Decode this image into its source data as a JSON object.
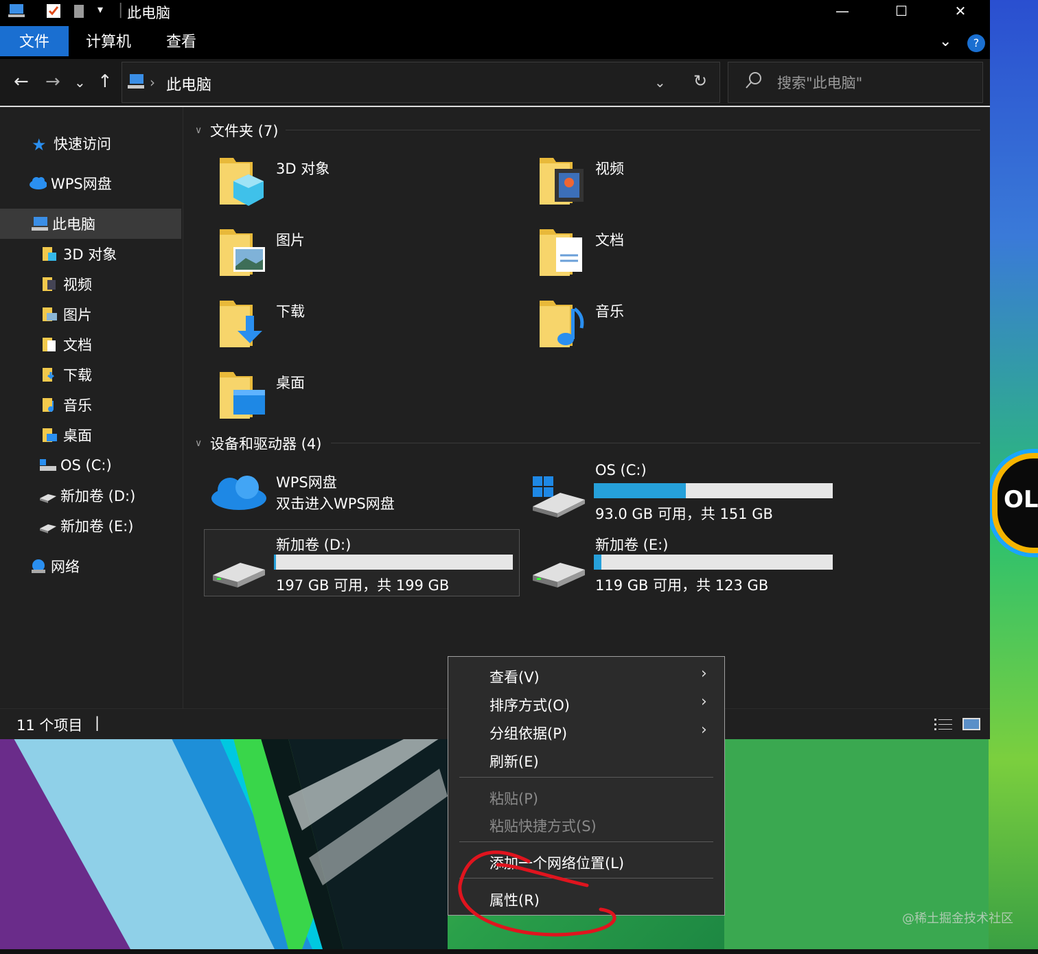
{
  "window": {
    "title": "此电脑",
    "minimize_glyph": "—",
    "maximize_glyph": "☐",
    "close_glyph": "✕"
  },
  "ribbon": {
    "tabs": [
      "文件",
      "计算机",
      "查看"
    ],
    "expand_glyph": "⌄",
    "help_label": "?"
  },
  "navigation": {
    "back": "←",
    "forward": "→",
    "recent": "⌄",
    "up": "↑"
  },
  "address": {
    "separator": "›",
    "path": "此电脑",
    "dropdown": "⌄",
    "refresh": "↻"
  },
  "search": {
    "placeholder": "搜索\"此电脑\"",
    "icon": "search-icon"
  },
  "sidebar": {
    "items": [
      {
        "label": "快速访问",
        "icon": "star-icon"
      },
      {
        "label": "WPS网盘",
        "icon": "cloud-icon"
      },
      {
        "label": "此电脑",
        "icon": "computer-icon",
        "selected": true
      },
      {
        "label": "3D 对象",
        "icon": "folder-3d-icon"
      },
      {
        "label": "视频",
        "icon": "folder-video-icon"
      },
      {
        "label": "图片",
        "icon": "folder-pictures-icon"
      },
      {
        "label": "文档",
        "icon": "folder-documents-icon"
      },
      {
        "label": "下载",
        "icon": "folder-downloads-icon"
      },
      {
        "label": "音乐",
        "icon": "folder-music-icon"
      },
      {
        "label": "桌面",
        "icon": "folder-desktop-icon"
      },
      {
        "label": "OS (C:)",
        "icon": "system-drive-icon"
      },
      {
        "label": "新加卷 (D:)",
        "icon": "drive-icon"
      },
      {
        "label": "新加卷 (E:)",
        "icon": "drive-icon"
      },
      {
        "label": "网络",
        "icon": "network-icon"
      }
    ]
  },
  "folders": {
    "heading": "文件夹 (7)",
    "items": [
      {
        "label": "3D 对象",
        "icon": "folder-3d-icon"
      },
      {
        "label": "视频",
        "icon": "folder-video-icon"
      },
      {
        "label": "图片",
        "icon": "folder-pictures-icon"
      },
      {
        "label": "文档",
        "icon": "folder-documents-icon"
      },
      {
        "label": "下载",
        "icon": "folder-downloads-icon"
      },
      {
        "label": "音乐",
        "icon": "folder-music-icon"
      },
      {
        "label": "桌面",
        "icon": "folder-desktop-icon"
      }
    ]
  },
  "devices": {
    "heading": "设备和驱动器 (4)",
    "wps": {
      "label": "WPS网盘",
      "sub": "双击进入WPS网盘"
    },
    "drives": [
      {
        "label": "OS (C:)",
        "sub": "93.0 GB 可用，共 151 GB",
        "used_fraction": 0.384
      },
      {
        "label": "新加卷 (D:)",
        "sub": "197 GB 可用，共 199 GB",
        "used_fraction": 0.01
      },
      {
        "label": "新加卷 (E:)",
        "sub": "119 GB 可用，共 123 GB",
        "used_fraction": 0.033
      }
    ],
    "bar_color": "#26a0da"
  },
  "status": {
    "count": "11 个项目",
    "separator": "|"
  },
  "context_menu": {
    "items": [
      {
        "label": "查看(V)",
        "submenu": true
      },
      {
        "label": "排序方式(O)",
        "submenu": true
      },
      {
        "label": "分组依据(P)",
        "submenu": true
      },
      {
        "label": "刷新(E)"
      },
      {
        "label": "粘贴(P)",
        "disabled": true
      },
      {
        "label": "粘贴快捷方式(S)",
        "disabled": true
      },
      {
        "label": "添加一个网络位置(L)"
      },
      {
        "label": "属性(R)"
      }
    ],
    "submenu_glyph": "›"
  },
  "wallpaper": {
    "badge_text": "OL",
    "watermark": "@稀土掘金技术社区"
  },
  "colors": {
    "accent": "#1a6fd1",
    "annotation": "#e0141e"
  }
}
